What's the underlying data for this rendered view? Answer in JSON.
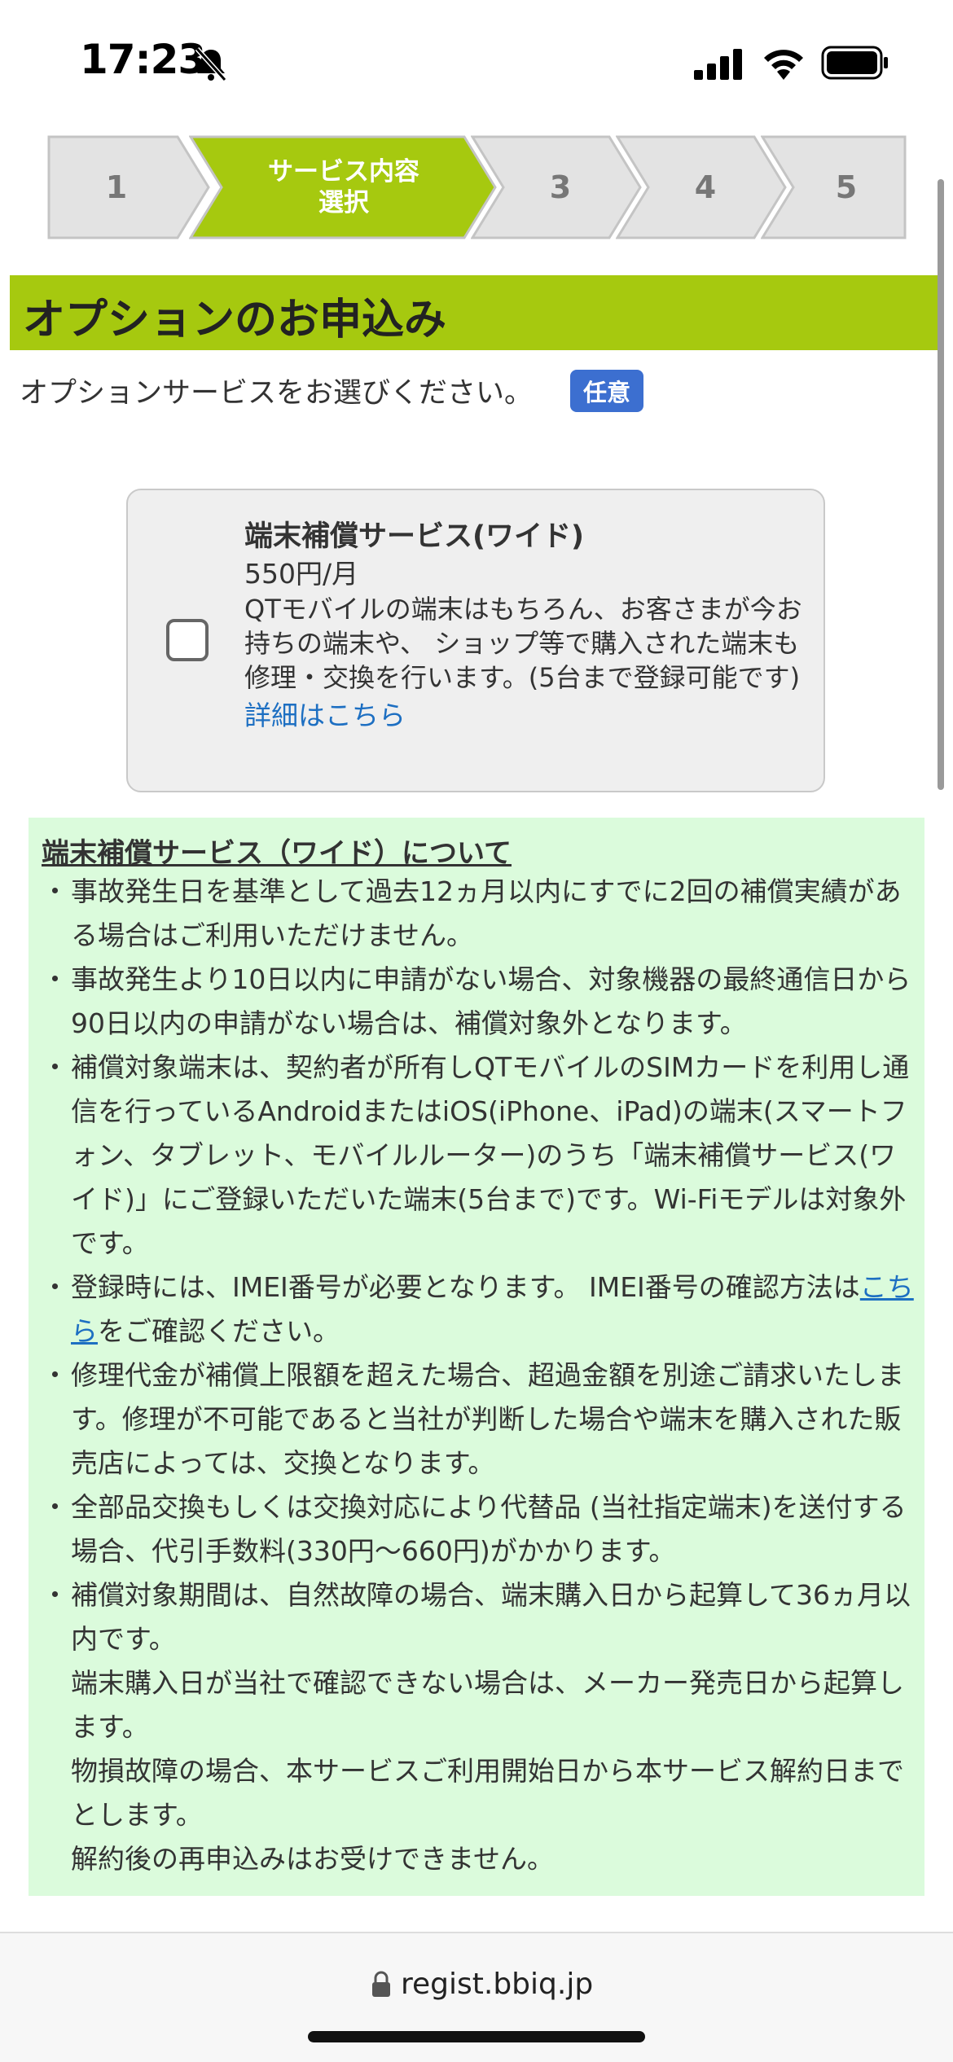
{
  "status_bar": {
    "time": "17:23",
    "icons": [
      "bell-slash-icon",
      "signal-icon",
      "wifi-icon",
      "battery-icon"
    ]
  },
  "stepper": {
    "steps": [
      {
        "label": "1",
        "active": false
      },
      {
        "label": "サービス内容\n選択",
        "active": true
      },
      {
        "label": "3",
        "active": false
      },
      {
        "label": "4",
        "active": false
      },
      {
        "label": "5",
        "active": false
      }
    ],
    "active_color": "#a6c90f",
    "inactive_color": "#e3e3e3"
  },
  "section": {
    "title": "オプションのお申込み",
    "instruction": "オプションサービスをお選びください。",
    "badge": "任意"
  },
  "option": {
    "name": "端末補償サービス(ワイド)",
    "price": "550円/月",
    "description": "QTモバイルの端末はもちろん、お客さまが今お持ちの端末や、 ショップ等で購入された端末も修理・交換を行います。(5台まで登録可能です)",
    "link": "詳細はこちら",
    "checked": false
  },
  "info": {
    "title": "端末補償サービス（ワイド）について",
    "items": [
      {
        "text": "事故発生日を基準として過去12ヵ月以内にすでに2回の補償実績がある場合はご利用いただけません。"
      },
      {
        "text": "事故発生より10日以内に申請がない場合、対象機器の最終通信日から90日以内の申請がない場合は、補償対象外となります。"
      },
      {
        "text": "補償対象端末は、契約者が所有しQTモバイルのSIMカードを利用し通信を行っているAndroidまたはiOS(iPhone、iPad)の端末(スマートフォン、タブレット、モバイルルーター)のうち「端末補償サービス(ワイド)」にご登録いただいた端末(5台まで)です。Wi-Fiモデルは対象外です。"
      },
      {
        "text_before": "登録時には、IMEI番号が必要となります。 IMEI番号の確認方法は",
        "link": "こちら",
        "text_after": "をご確認ください。"
      },
      {
        "text": "修理代金が補償上限額を超えた場合、超過金額を別途ご請求いたします。修理が不可能であると当社が判断した場合や端末を購入された販売店によっては、交換となります。"
      },
      {
        "text": "全部品交換もしくは交換対応により代替品 (当社指定端末)を送付する場合、代引手数料(330円〜660円)がかかります。"
      },
      {
        "text": "補償対象期間は、自然故障の場合、端末購入日から起算して36ヵ月以内です。"
      },
      {
        "text": "端末購入日が当社で確認できない場合は、メーカー発売日から起算します。"
      },
      {
        "text": "物損故障の場合、本サービスご利用開始日から本サービス解約日までとします。"
      },
      {
        "text": "解約後の再申込みはお受けできません。"
      }
    ]
  },
  "browser": {
    "url": "regist.bbiq.jp"
  }
}
